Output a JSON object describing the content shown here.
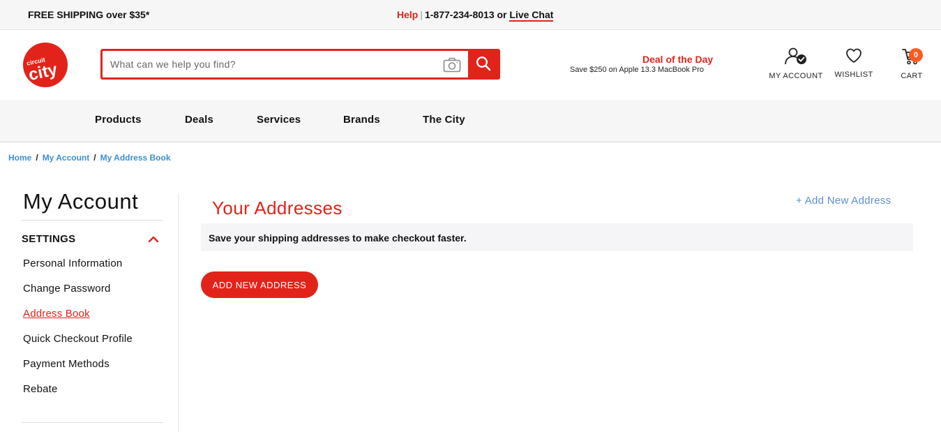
{
  "topbar": {
    "free_shipping": "FREE SHIPPING over $35*",
    "help": "Help",
    "separator": "|",
    "phone_text": "1-877-234-8013 or",
    "live_chat": "Live Chat"
  },
  "header": {
    "logo_alt": "circuit city",
    "search": {
      "placeholder": "What can we help you find?",
      "value": ""
    },
    "deal": {
      "title": "Deal of the Day",
      "subtitle": "Save $250 on Apple 13.3 MacBook Pro"
    },
    "my_account": "MY ACCOUNT",
    "wishlist": "WISHLIST",
    "cart": "CART",
    "cart_count": "0",
    "brand_color": "#e2231a",
    "badge_color": "#ff5a1f"
  },
  "nav": {
    "items": [
      {
        "label": "Products"
      },
      {
        "label": "Deals"
      },
      {
        "label": "Services"
      },
      {
        "label": "Brands"
      },
      {
        "label": "The City"
      }
    ]
  },
  "breadcrumb": [
    {
      "label": "Home"
    },
    {
      "label": "My Account"
    },
    {
      "label": "My Address Book"
    }
  ],
  "sidebar": {
    "title": "My Account",
    "section": "SETTINGS",
    "items": [
      {
        "label": "Personal Information"
      },
      {
        "label": "Change Password"
      },
      {
        "label": "Address Book"
      },
      {
        "label": "Quick Checkout Profile"
      },
      {
        "label": "Payment Methods"
      },
      {
        "label": "Rebate"
      }
    ],
    "active_item": "Address Book"
  },
  "content": {
    "title": "Your Addresses",
    "add_link": "+ Add New Address",
    "info": "Save your shipping addresses to make checkout faster.",
    "add_button": "ADD NEW ADDRESS"
  },
  "icons": [
    "camera-icon",
    "search-icon",
    "account-check-icon",
    "heart-icon",
    "cart-icon",
    "chevron-up-icon"
  ]
}
